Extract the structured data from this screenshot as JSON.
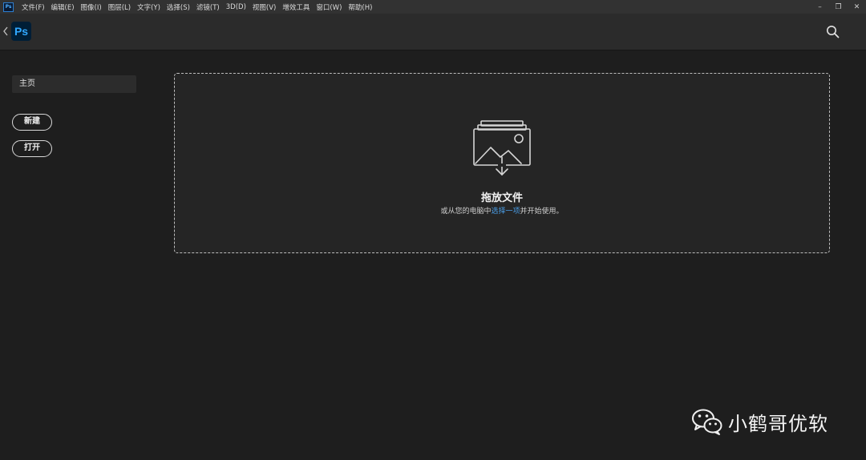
{
  "menubar": {
    "app_icon": "Ps",
    "items": [
      "文件(F)",
      "编辑(E)",
      "图像(I)",
      "图层(L)",
      "文字(Y)",
      "选择(S)",
      "滤镜(T)",
      "3D(D)",
      "视图(V)",
      "增效工具",
      "窗口(W)",
      "帮助(H)"
    ],
    "window_controls": {
      "minimize": "–",
      "restore": "❐",
      "close": "✕"
    }
  },
  "header": {
    "logo": "Ps",
    "back_icon": "chevron-left-icon",
    "search_icon": "search-icon"
  },
  "sidebar": {
    "home_label": "主页",
    "new_label": "新建",
    "open_label": "打开"
  },
  "dropzone": {
    "title": "拖放文件",
    "sub_prefix": "或从您的电脑中",
    "sub_link": "选择一项",
    "sub_suffix": "并开始使用。",
    "icon": "image-download-icon"
  },
  "watermark": {
    "text": "小鹤哥优软",
    "icon": "wechat-icon"
  },
  "colors": {
    "accent_link": "#4a9ee8",
    "ps_logo_bg": "#001e36",
    "ps_logo_fg": "#31a8ff"
  }
}
